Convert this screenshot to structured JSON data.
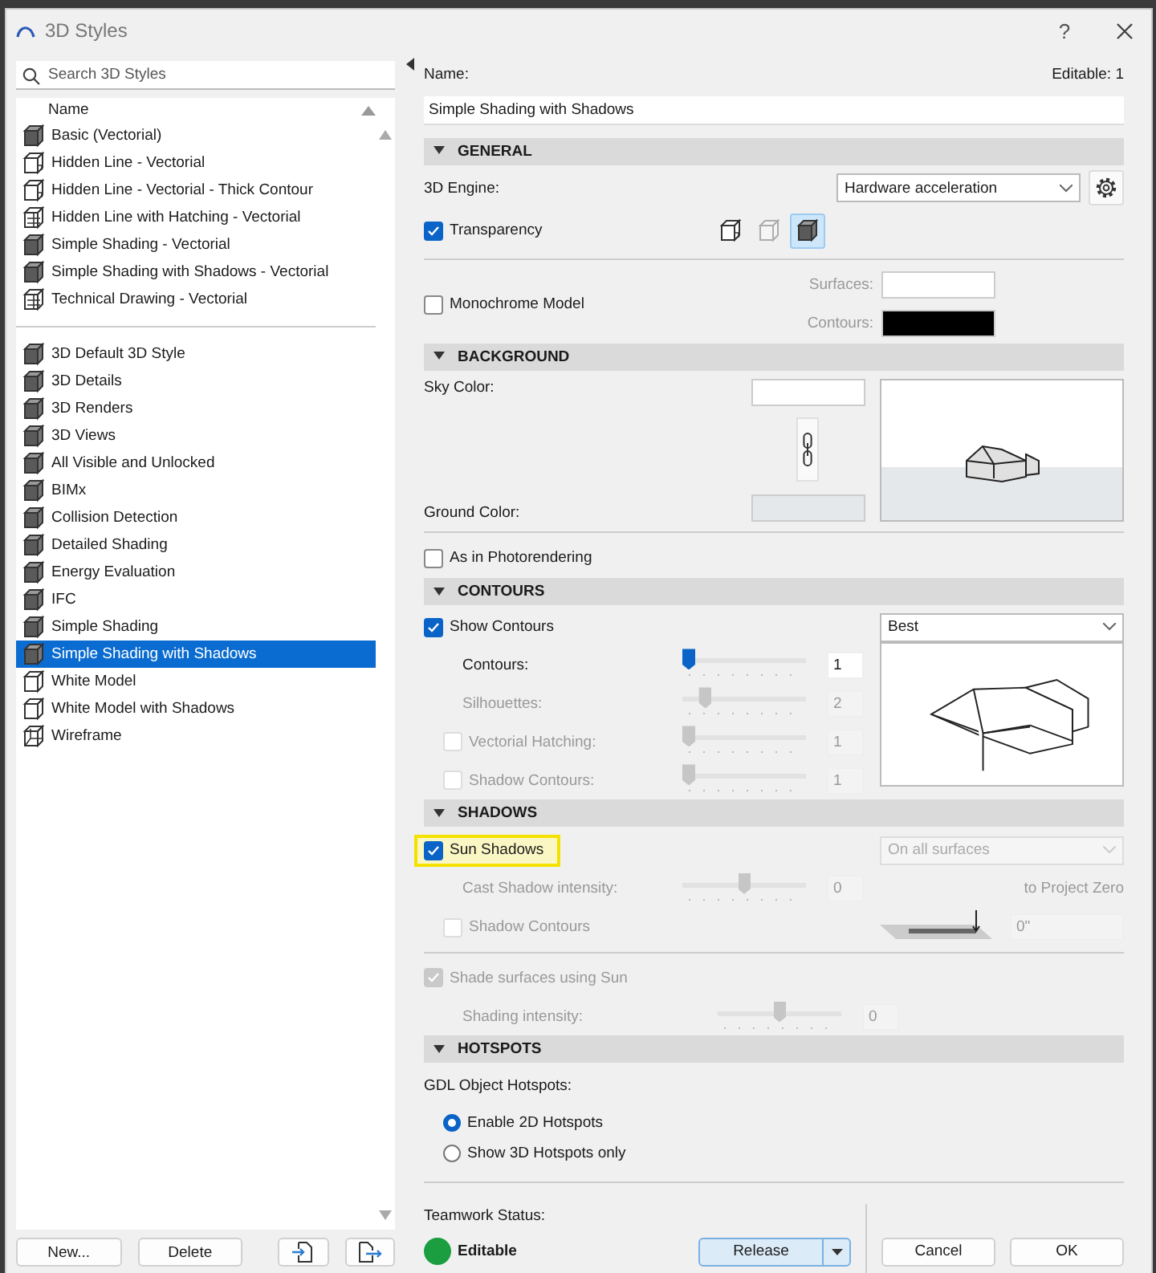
{
  "window": {
    "title": "3D Styles",
    "help": "?"
  },
  "search": {
    "placeholder": "Search 3D Styles"
  },
  "list": {
    "column": "Name",
    "groups": [
      [
        {
          "label": "Basic (Vectorial)",
          "kind": "shaded",
          "selected": false
        },
        {
          "label": "Hidden Line - Vectorial",
          "kind": "hidden",
          "selected": false
        },
        {
          "label": "Hidden Line - Vectorial - Thick Contour",
          "kind": "hidden",
          "selected": false
        },
        {
          "label": "Hidden Line with Hatching - Vectorial",
          "kind": "hatched",
          "selected": false
        },
        {
          "label": "Simple Shading - Vectorial",
          "kind": "shaded",
          "selected": false
        },
        {
          "label": "Simple Shading with Shadows - Vectorial",
          "kind": "shaded",
          "selected": false
        },
        {
          "label": "Technical Drawing - Vectorial",
          "kind": "hatched",
          "selected": false
        }
      ],
      [
        {
          "label": "3D Default 3D Style",
          "kind": "shaded",
          "selected": false
        },
        {
          "label": "3D Details",
          "kind": "shaded",
          "selected": false
        },
        {
          "label": "3D Renders",
          "kind": "shaded",
          "selected": false
        },
        {
          "label": "3D Views",
          "kind": "shaded",
          "selected": false
        },
        {
          "label": "All Visible and Unlocked",
          "kind": "shaded",
          "selected": false
        },
        {
          "label": "BIMx",
          "kind": "shaded",
          "selected": false
        },
        {
          "label": "Collision Detection",
          "kind": "shaded",
          "selected": false
        },
        {
          "label": "Detailed Shading",
          "kind": "shaded",
          "selected": false
        },
        {
          "label": "Energy Evaluation",
          "kind": "shaded",
          "selected": false
        },
        {
          "label": "IFC",
          "kind": "shaded",
          "selected": false
        },
        {
          "label": "Simple Shading",
          "kind": "shaded",
          "selected": false
        },
        {
          "label": "Simple Shading with Shadows",
          "kind": "shaded",
          "selected": true
        },
        {
          "label": "White Model",
          "kind": "white",
          "selected": false
        },
        {
          "label": "White Model with Shadows",
          "kind": "white",
          "selected": false
        },
        {
          "label": "Wireframe",
          "kind": "wireframe",
          "selected": false
        }
      ]
    ]
  },
  "left_buttons": [
    "New...",
    "Delete"
  ],
  "name": {
    "label": "Name:",
    "editable": "Editable: 1",
    "value": "Simple Shading with Shadows"
  },
  "general": {
    "title": "GENERAL",
    "expanded": true,
    "engine_label": "3D Engine:",
    "engine_value": "Hardware acceleration",
    "transparency": {
      "label": "Transparency",
      "checked": true
    },
    "modes": [
      {
        "kind": "hidden",
        "selected": false,
        "disabled": false
      },
      {
        "kind": "white",
        "selected": false,
        "disabled": true
      },
      {
        "kind": "shaded",
        "selected": true,
        "disabled": false
      }
    ],
    "monochrome": {
      "label": "Monochrome Model",
      "checked": false
    },
    "surfaces": {
      "label": "Surfaces:",
      "color": "#ffffff"
    },
    "contours": {
      "label": "Contours:",
      "color": "#000000"
    }
  },
  "background": {
    "title": "BACKGROUND",
    "expanded": true,
    "sky": {
      "label": "Sky Color:",
      "color": "#ffffff"
    },
    "ground": {
      "label": "Ground Color:",
      "color": "#e4e8eb"
    },
    "photorendering": {
      "label": "As in Photorendering",
      "checked": false
    }
  },
  "contours": {
    "title": "CONTOURS",
    "expanded": true,
    "show": {
      "label": "Show Contours",
      "checked": true
    },
    "quality": "Best",
    "rows": [
      {
        "kind": "plain",
        "label": "Contours:",
        "level": 0,
        "value": "1",
        "disabled": false
      },
      {
        "kind": "plain",
        "label": "Silhouettes:",
        "level": 0.15,
        "value": "2",
        "disabled": true
      },
      {
        "kind": "checkbox",
        "label": "Vectorial Hatching:",
        "checked": false,
        "level": 0,
        "value": "1",
        "disabled": true
      },
      {
        "kind": "checkbox",
        "label": "Shadow Contours:",
        "checked": false,
        "level": 0,
        "value": "1",
        "disabled": true
      }
    ]
  },
  "shadows": {
    "title": "SHADOWS",
    "expanded": true,
    "sun": {
      "label": "Sun Shadows",
      "checked": true,
      "highlighted": true
    },
    "mode": {
      "value": "On all surfaces",
      "disabled": true
    },
    "cast": {
      "label": "Cast Shadow intensity:",
      "level": 0.5,
      "value": "0",
      "disabled": true
    },
    "project_zero": "to Project Zero",
    "shadow_contours": {
      "label": "Shadow Contours",
      "checked": false,
      "disabled": true
    },
    "offset": "0\"",
    "shade": {
      "label": "Shade surfaces using Sun",
      "checked": true,
      "disabled": true
    },
    "shading": {
      "label": "Shading intensity:",
      "level": 0.5,
      "value": "0",
      "disabled": true
    }
  },
  "hotspots": {
    "title": "HOTSPOTS",
    "expanded": true,
    "label": "GDL Object Hotspots:",
    "options": [
      {
        "label": "Enable 2D Hotspots",
        "selected": true
      },
      {
        "label": "Show 3D Hotspots only",
        "selected": false
      }
    ]
  },
  "footer": {
    "status_label": "Teamwork Status:",
    "status": "Editable",
    "release": "Release",
    "buttons": [
      "Cancel",
      "OK"
    ]
  }
}
